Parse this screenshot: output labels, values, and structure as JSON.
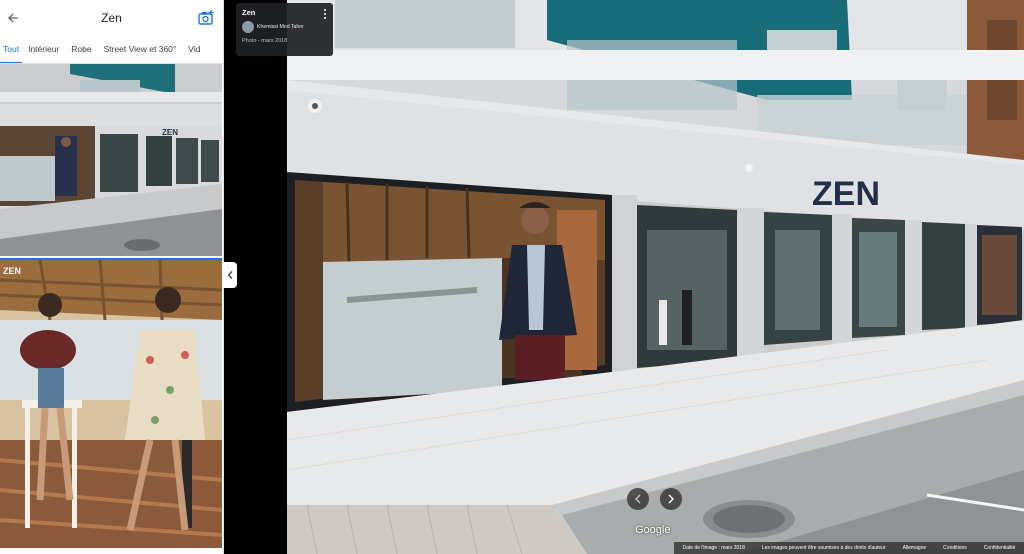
{
  "header": {
    "title": "Zen"
  },
  "tabs": [
    {
      "label": "Tout"
    },
    {
      "label": "Intérieur"
    },
    {
      "label": "Robe"
    },
    {
      "label": "Street View et 360°"
    },
    {
      "label": "Vid"
    }
  ],
  "photos": {
    "first": {
      "sign": "ZEN"
    },
    "second": {
      "sign": "ZEN"
    }
  },
  "main": {
    "sign": "ZEN"
  },
  "info_card": {
    "title": "Zen",
    "author": "Khemissi Mnd Taher",
    "date": "Photo - mars 2018"
  },
  "google": "Google",
  "footer": {
    "image_date": "Date de l'image : mars 2018",
    "copyright": "Les images peuvent être soumises à des droits d'auteur",
    "country": "Allemagne",
    "privacy": "Conditions",
    "terms": "Confidentialité"
  },
  "colors": {
    "accent": "#1a73e8"
  }
}
